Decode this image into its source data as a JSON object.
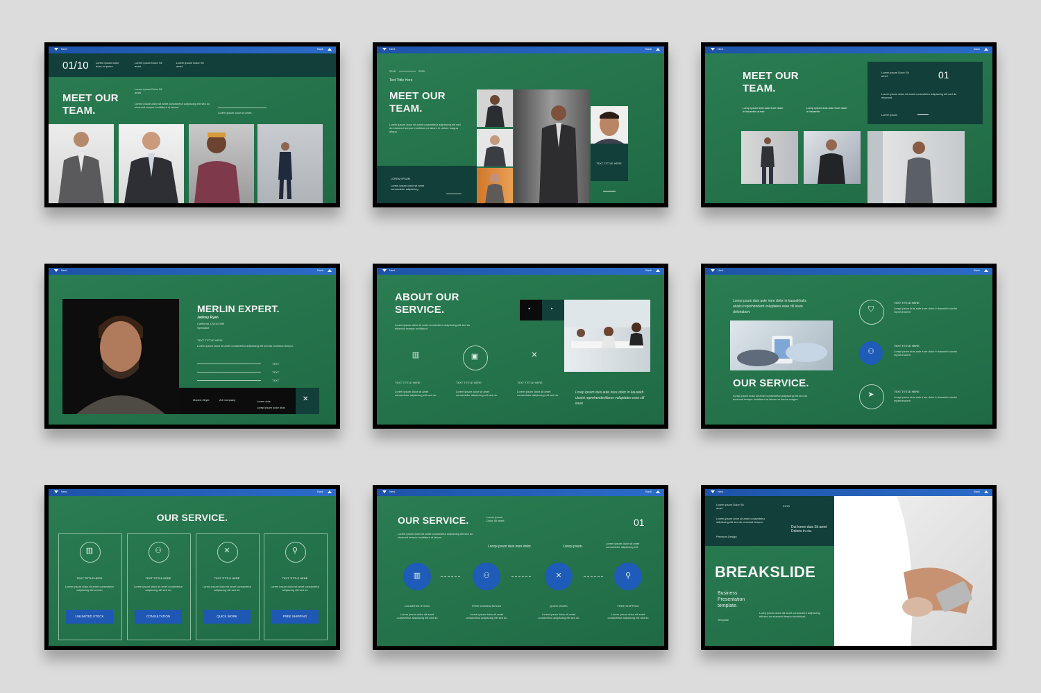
{
  "topbar": {
    "left_label": "Next",
    "right_label": "Back"
  },
  "s1": {
    "page": "01/10",
    "title_line1": "MEET OUR",
    "title_line2": "TEAM.",
    "col1": "Lorem ipsum dolor dues in ipsum",
    "col2": "Lorem ipsum Dolor Sit amet.",
    "col3": "Lorem ipsum Dolor Sit amet.",
    "sub": "Lorem ipsum Dolor Sit amet.",
    "body": "Lorem ipsum dolor sit amet consectetur adipiscing elit sed do eiusmod tempor incididunt ut labore.",
    "link": "Lorem ipsum dolor sit amet."
  },
  "s2": {
    "year_from": "2018",
    "year_to": "2020",
    "kicker": "Text Tittle Here",
    "title_line1": "MEET OUR",
    "title_line2": "TEAM.",
    "body": "Lorem ipsum dolor sit amet consectetur adipiscing elit sed do eiusmod tempor incididunt ut labore et dolore magna aliqua.",
    "box_title": "LOREM IPSUM",
    "box_body": "Lorem ipsum dolor sit amet consectetur adipiscing.",
    "label": "TEXT TITTLE HERE"
  },
  "s3": {
    "title_line1": "MEET OUR",
    "title_line2": "TEAM.",
    "num": "01",
    "box_head": "Lorem ipsum Dolor Sit amet.",
    "box_body": "Lorem ipsum dolor sit amet consectetur adipiscing elit sed do eiusmod.",
    "box_link": "Lorem ipsum",
    "col1": "Lorep ipsum duis aute irure dolor in kausekh ulusisi",
    "col2": "Lorep ipsum duis aute irure dolor in kausekh"
  },
  "s4": {
    "title": "MERLIN EXPERT.",
    "name": "Jadosy Ryan",
    "date": "California, 03/14/1990",
    "role": "Specialist",
    "sub": "TEXT TITTLE HERE",
    "body": "Lorem ipsum dolor sit amet consectetur adipiscing elit sed do eiusmod tempor.",
    "bar1": "TEXT",
    "bar2": "TEXT",
    "bar3": "TEXT",
    "f1": "Modern Style",
    "f2": "Art Company",
    "f3": "Lorem duis",
    "f4": "Lorep ipsum dolor duis",
    "close": "✕"
  },
  "s5": {
    "title_line1": "ABOUT OUR",
    "title_line2": "SERVICE.",
    "body": "Lorem ipsum dolor sit amet consectetur adipiscing elit sed do eiusmod tempor incididunt.",
    "items": [
      {
        "icon": "▥",
        "label": "TEXT TITTLE HERE",
        "desc": "Lorem ipsum dolor sit amet consectetur adipiscing elit sed do."
      },
      {
        "icon": "▣",
        "label": "TEXT TITTLE HERE",
        "desc": "Lorem ipsum dolor sit amet consectetur adipiscing elit sed do."
      },
      {
        "icon": "✕",
        "label": "TEXT TITTLE HERE",
        "desc": "Lorem ipsum dolor sit amet consectetur adipiscing elit sed do."
      }
    ],
    "quote": "Lorep ipsum duis aute irure dolor in kausekh ulusisi reprehenderitlares voluptates esse cill inure"
  },
  "s6": {
    "intro": "Lorep ipsum duis aute irure dolor in kausekhulis ulusisi reprehenderit voluptates esse cill inure doloriaborv",
    "title": "OUR SERVICE.",
    "body": "Lorep ipsum dolor sit amet consectetur adipiscing elit sed do eiusmod tempor incididunt ut labore et dolore magna.",
    "items": [
      {
        "icon": "⛉",
        "label": "TEXT TITTLE HERE",
        "desc": "Lorep ipsum duis aute irure dolor in kausekh ulusisi reprehenderit"
      },
      {
        "icon": "⚇",
        "label": "TEXT TITTLE HERE",
        "desc": "Lorep ipsum duis aute irure dolor in kausekh ulusisi reprehenderit"
      },
      {
        "icon": "➤",
        "label": "TEXT TITTLE HERE",
        "desc": "Lorep ipsum duis aute irure dolor in kausekh ulusisi reprehenderit"
      }
    ]
  },
  "s7": {
    "title": "OUR SERVICE.",
    "cards": [
      {
        "icon": "▥",
        "label": "TEXT TITTLE HERE",
        "desc": "Lorem ipsum dolor sit amet consectetur adipiscing elit sed do",
        "btn": "UNLIMITED STOCK"
      },
      {
        "icon": "⚇",
        "label": "TEXT TITTLE HERE",
        "desc": "Lorem ipsum dolor sit amet consectetur adipiscing elit sed do",
        "btn": "CONSULTATION"
      },
      {
        "icon": "✕",
        "label": "TEXT TITTLE HERE",
        "desc": "Lorem ipsum dolor sit amet consectetur adipiscing elit sed do",
        "btn": "QUICK WORK"
      },
      {
        "icon": "⚲",
        "label": "TEXT TITTLE HERE",
        "desc": "Lorem ipsum dolor sit amet consectetur adipiscing elit sed do",
        "btn": "FREE SHIPPING"
      }
    ]
  },
  "s8": {
    "title": "OUR SERVICE.",
    "side": "Lorem ipsum Dolor Sit amet.",
    "num": "01",
    "body": "Lorem ipsum dolor sit amet consectetur adipiscing elit sed do eiusmod tempor incididunt ut labore.",
    "tag1": "Lorep ipsum duis irure dolor.",
    "tag2": "Lorep ipsum.",
    "right_body": "Lorem ipsum dolor sit amet consectetur adipiscing elit.",
    "items": [
      {
        "icon": "▥",
        "label": "UNLIMITED STOCK",
        "desc": "Lorem ipsum dolor sit amet consectetur adipiscing elit sed do"
      },
      {
        "icon": "⚇",
        "label": "FREE CONSULTATION",
        "desc": "Lorem ipsum dolor sit amet consectetur adipiscing elit sed do"
      },
      {
        "icon": "✕",
        "label": "QUICK WORK",
        "desc": "Lorem ipsum dolor sit amet consectetur adipiscing elit sed do"
      },
      {
        "icon": "⚲",
        "label": "FREE SHIPPING",
        "desc": "Lorem ipsum dolor sit amet consectetur adipiscing elit sed do"
      }
    ]
  },
  "s9": {
    "head": "Lorem ipsum Dolor Sit amet.",
    "page": "01/10",
    "body": "Lorem ipsum dolor sit amet consectetur adipiscing elit sed do eiusmod tempor.",
    "premium": "Premium Design",
    "quote": "Dui lorem duis Sit amet Doloris in ciu.",
    "title": "BREAKSLIDE",
    "sub_line1": "Business",
    "sub_line2": "Presentation",
    "sub_line3": "template.",
    "template": "Template",
    "desc": "Lorep ipsum dolor sit amet consectetur adipiscing elit sed do eiusmod tempor incididunt."
  },
  "colors": {
    "background": "#dcdcdc",
    "slide_green": "#2b7d52",
    "dark_panel": "#123f3a",
    "accent_blue": "#1e57b4"
  }
}
